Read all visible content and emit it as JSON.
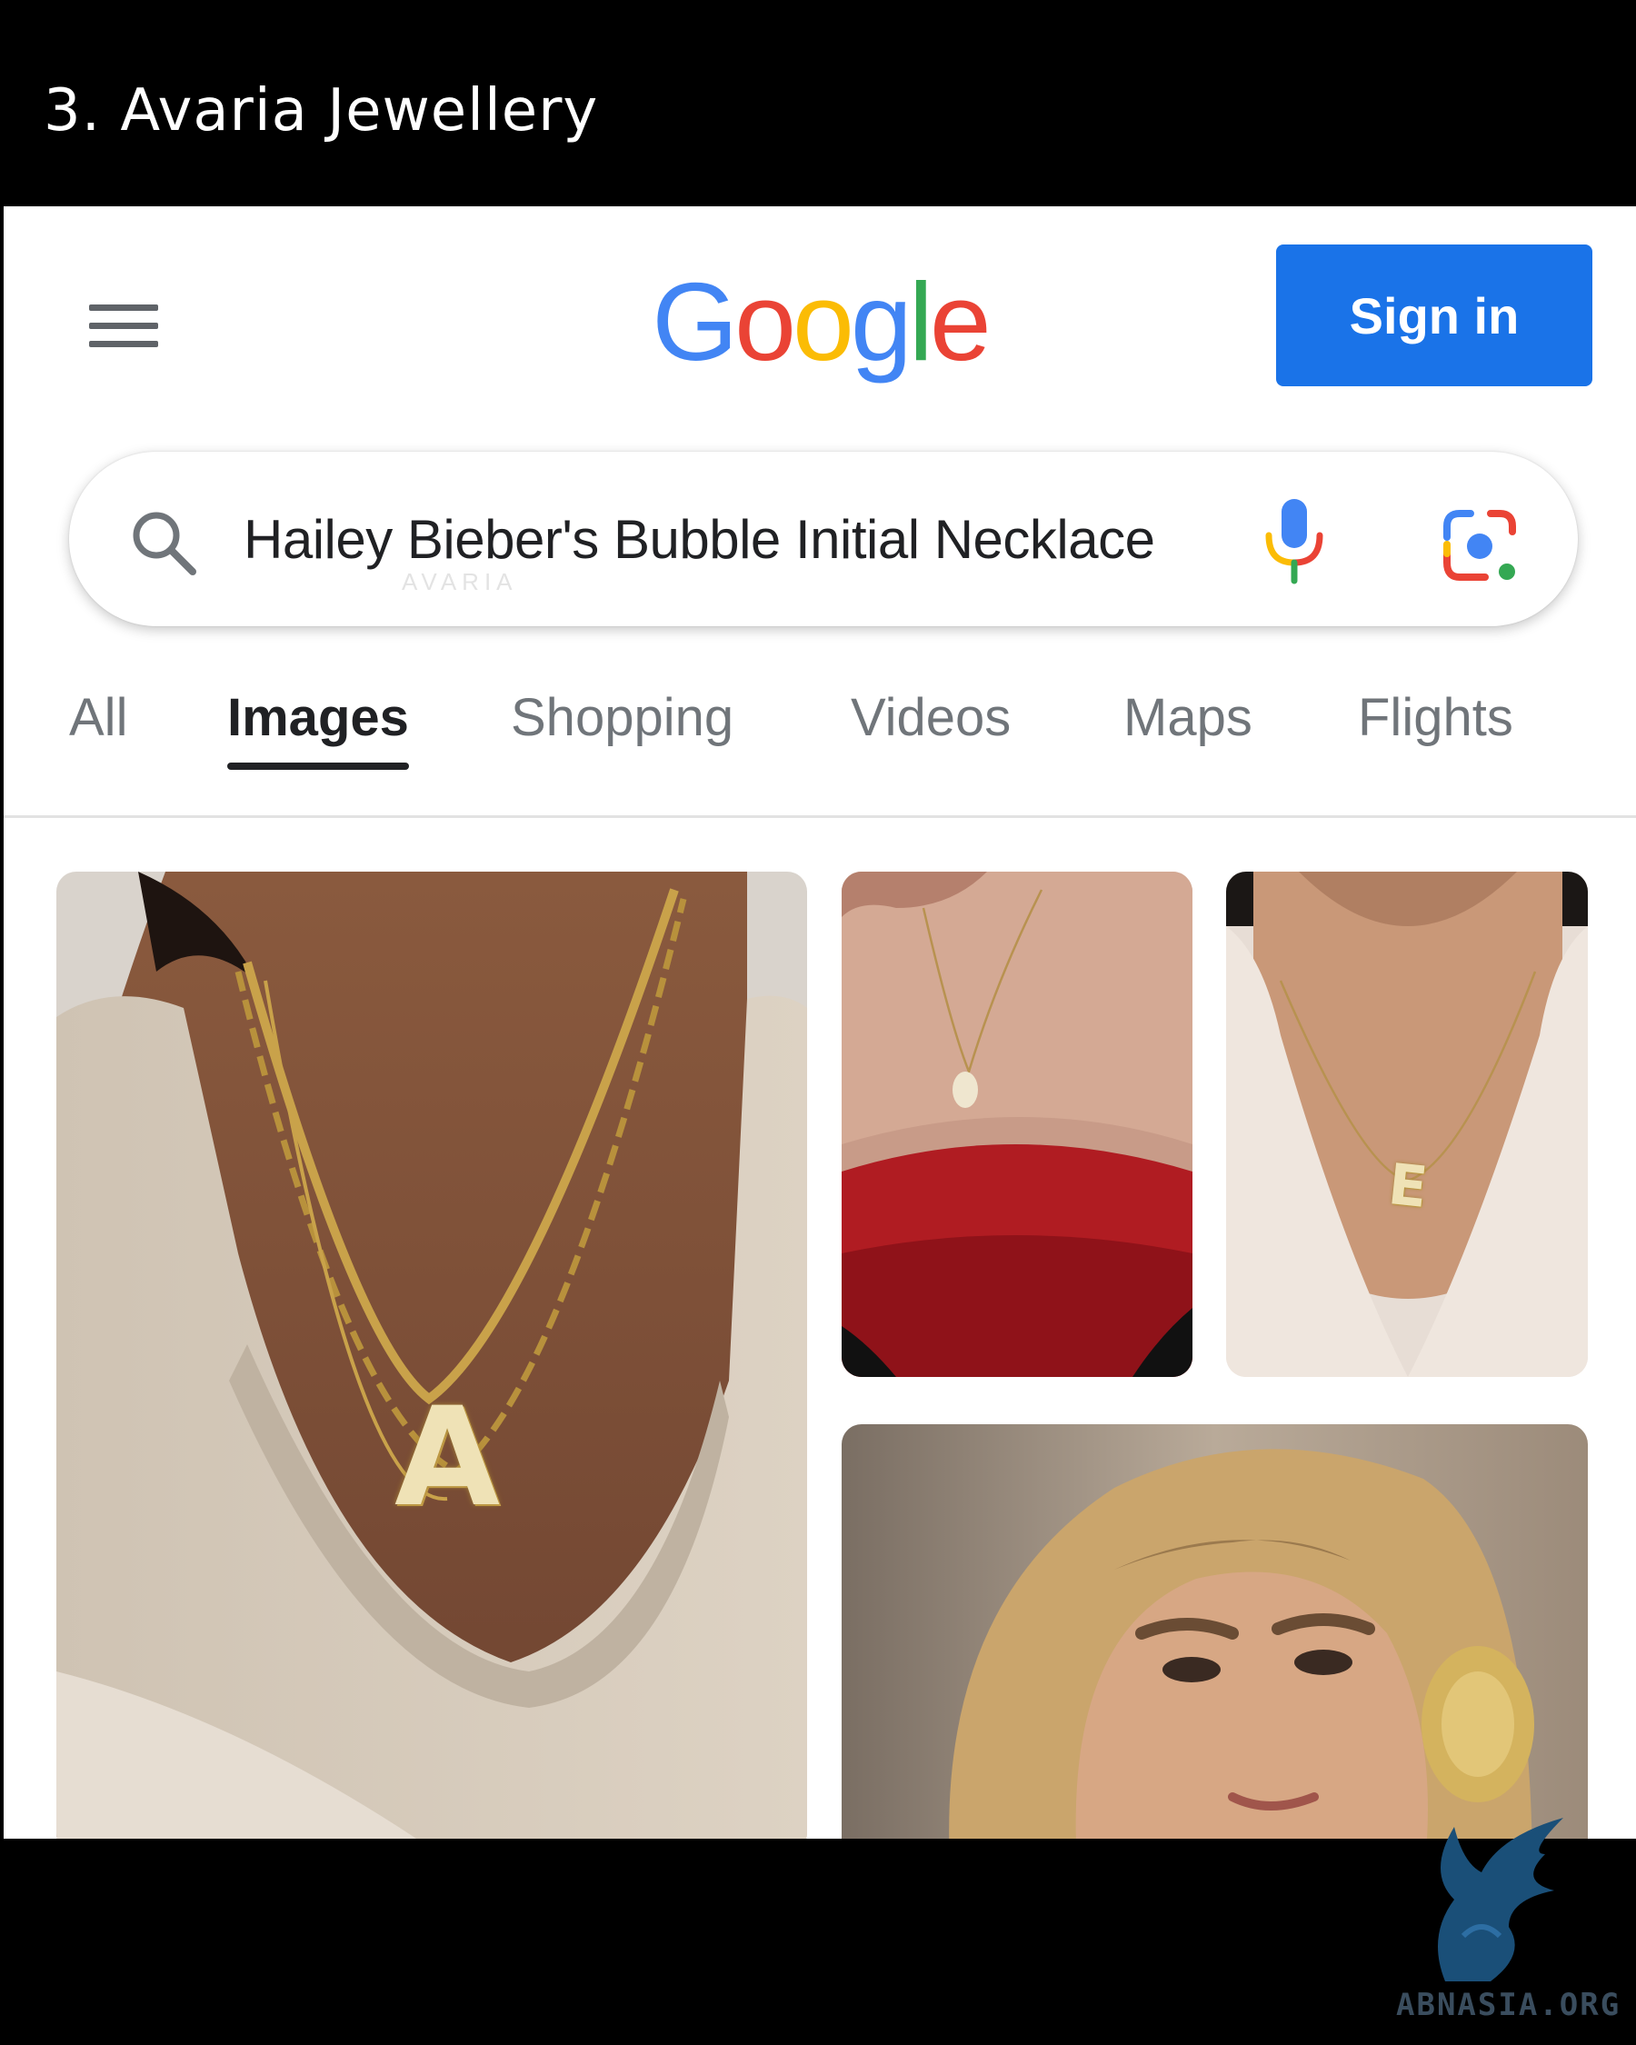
{
  "caption": "3. Avaria Jewellery",
  "header": {
    "logo_letters": [
      {
        "char": "G",
        "color": "#4285f4"
      },
      {
        "char": "o",
        "color": "#ea4335"
      },
      {
        "char": "o",
        "color": "#fbbc05"
      },
      {
        "char": "g",
        "color": "#4285f4"
      },
      {
        "char": "l",
        "color": "#34a853"
      },
      {
        "char": "e",
        "color": "#ea4335"
      }
    ],
    "signin_label": "Sign in",
    "signin_color": "#1a73e8",
    "menu_icon": "hamburger-menu-icon"
  },
  "search": {
    "query": "Hailey Bieber's Bubble Initial Necklace",
    "watermark": "AVARIA",
    "icons": [
      "search-icon",
      "microphone-icon",
      "google-lens-icon"
    ]
  },
  "tabs": [
    {
      "label": "All",
      "active": false
    },
    {
      "label": "Images",
      "active": true
    },
    {
      "label": "Shopping",
      "active": false
    },
    {
      "label": "Videos",
      "active": false
    },
    {
      "label": "Maps",
      "active": false
    },
    {
      "label": "Flights",
      "active": false
    }
  ],
  "results": [
    {
      "pendant_letter": "A",
      "description": "gold chains with bubble letter pendant on beige ribbed top"
    },
    {
      "pendant_letter": "",
      "description": "small bubble initial pendant over red top"
    },
    {
      "pendant_letter": "E",
      "description": "bubble letter pendant with cream blazer"
    },
    {
      "pendant_letter": "",
      "description": "portrait with gold hammered disc earring"
    }
  ],
  "watermark_brand": {
    "text": "ABNASIA.ORG",
    "icon": "griffin-logo-icon"
  }
}
